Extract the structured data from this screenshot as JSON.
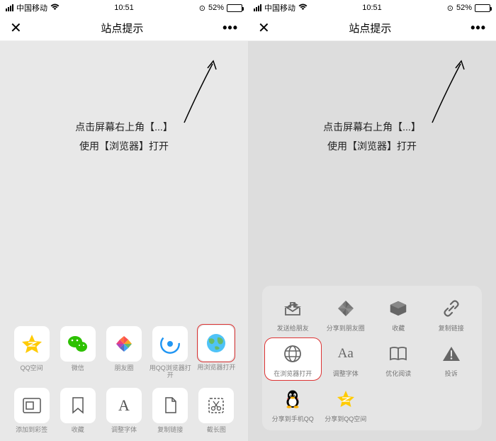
{
  "status": {
    "carrier": "中国移动",
    "time": "10:51",
    "battery_pct": "52%"
  },
  "header": {
    "close": "✕",
    "title": "站点提示",
    "more": "•••"
  },
  "instruction": {
    "line1": "点击屏幕右上角【...】",
    "line2": "使用【浏览器】打开"
  },
  "left_sheet": {
    "row1": [
      {
        "id": "qzone",
        "label": "QQ空间"
      },
      {
        "id": "wechat",
        "label": "微信"
      },
      {
        "id": "moments",
        "label": "朋友圈"
      },
      {
        "id": "qqbrowser",
        "label": "用QQ浏览器打开"
      },
      {
        "id": "browser",
        "label": "用浏览器打开"
      }
    ],
    "row2": [
      {
        "id": "bookmark",
        "label": "添加到彩签"
      },
      {
        "id": "favorite",
        "label": "收藏"
      },
      {
        "id": "font",
        "label": "调整字体"
      },
      {
        "id": "copy",
        "label": "复制链接"
      },
      {
        "id": "screenshot",
        "label": "截长图"
      }
    ]
  },
  "right_sheet": {
    "row1": [
      {
        "id": "send-friend",
        "label": "发送给朋友"
      },
      {
        "id": "share-moments",
        "label": "分享到朋友圈"
      },
      {
        "id": "collect",
        "label": "收藏"
      },
      {
        "id": "copy-link",
        "label": "复制链接"
      }
    ],
    "row2": [
      {
        "id": "open-browser",
        "label": "在浏览器打开"
      },
      {
        "id": "adjust-font",
        "label": "调整字体"
      },
      {
        "id": "optimize-read",
        "label": "优化阅读"
      },
      {
        "id": "report",
        "label": "投诉"
      }
    ],
    "row3": [
      {
        "id": "share-qq",
        "label": "分享到手机QQ"
      },
      {
        "id": "share-qzone",
        "label": "分享到QQ空间"
      }
    ]
  }
}
